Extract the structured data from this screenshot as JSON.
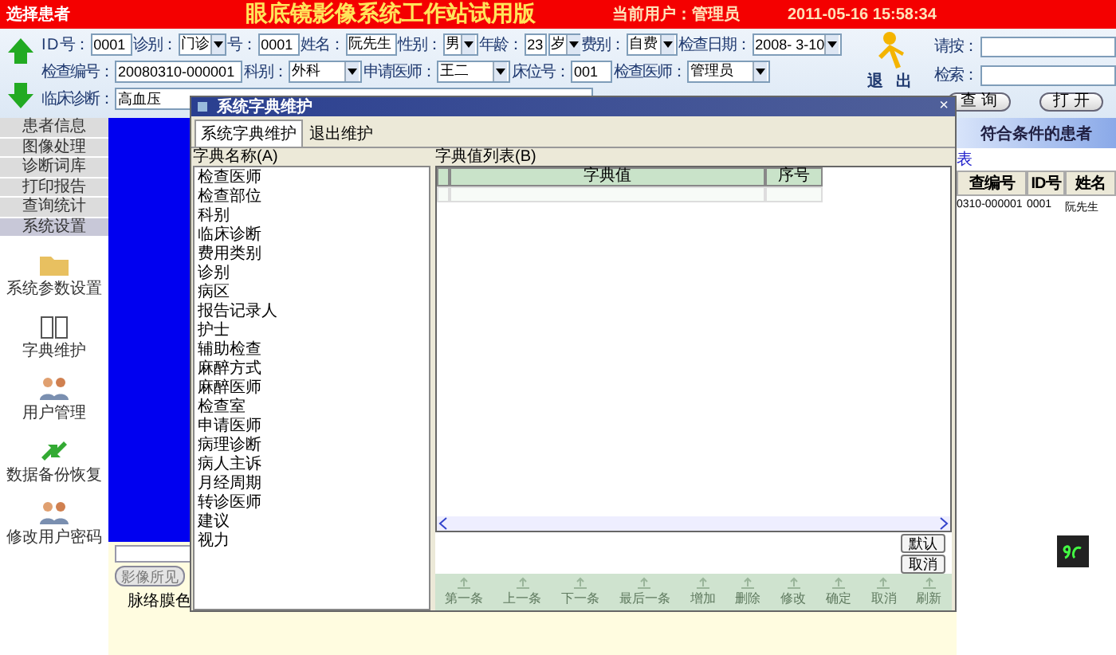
{
  "header": {
    "left_label": "选择患者",
    "title": "眼底镜影像系统工作站试用版",
    "user": "当前用户：管理员",
    "datetime": "2011-05-16 15:58:34"
  },
  "form": {
    "rows": [
      {
        "fields": [
          {
            "label": "I D 号：",
            "value": "0001",
            "kind": "text"
          },
          {
            "label": "诊别：",
            "value": "门诊",
            "kind": "select"
          },
          {
            "label": "号：",
            "value": "0001",
            "kind": "text"
          },
          {
            "label": "姓名：",
            "value": "阮先生",
            "kind": "text"
          },
          {
            "label": "性别：",
            "value": "男",
            "kind": "select"
          },
          {
            "label": "年龄：",
            "value": "23",
            "kind": "text"
          },
          {
            "value": "岁",
            "kind": "select"
          },
          {
            "label": "费别：",
            "value": "自费",
            "kind": "select"
          },
          {
            "label": "检查日期：",
            "value": "2008- 3-10",
            "kind": "select"
          }
        ]
      },
      {
        "fields": [
          {
            "label": "检查编号：",
            "value": "20080310-000001",
            "kind": "text"
          },
          {
            "label": "科别：",
            "value": "外科",
            "kind": "select"
          },
          {
            "label": "申请医师：",
            "value": "王二",
            "kind": "select"
          },
          {
            "label": "床位号：",
            "value": "001",
            "kind": "text"
          },
          {
            "label": "检查医师：",
            "value": "管理员",
            "kind": "select"
          }
        ]
      },
      {
        "fields": [
          {
            "label": "临床诊断：",
            "value": "高血压",
            "kind": "text"
          }
        ]
      }
    ]
  },
  "exit_button": [
    "退",
    "出"
  ],
  "search": {
    "fields": [
      {
        "label": "请按："
      },
      {
        "label": "检索："
      }
    ],
    "buttons": [
      "查 询",
      "打 开"
    ]
  },
  "nav": {
    "menu": [
      {
        "label": "患者信息",
        "selected": false
      },
      {
        "label": "图像处理",
        "selected": false
      },
      {
        "label": "诊断词库",
        "selected": false
      },
      {
        "label": "打印报告",
        "selected": false
      },
      {
        "label": "查询统计",
        "selected": false
      },
      {
        "label": "系统设置",
        "selected": true
      }
    ],
    "tools": [
      {
        "label": "系统参数设置",
        "kind": "folder"
      },
      {
        "label": "字典维护",
        "kind": "book"
      },
      {
        "label": "用户管理",
        "kind": "users"
      },
      {
        "label": "数据备份恢复",
        "kind": "arrows"
      },
      {
        "label": "修改用户密码",
        "kind": "users"
      }
    ]
  },
  "report": {
    "buttons": [
      "影像所见"
    ],
    "text": "脉络膜色"
  },
  "results": {
    "title": "符合条件的患者",
    "caption": "表",
    "columns": [
      "查编号",
      "ID号",
      "姓名"
    ],
    "rows": [
      [
        "0310-000001",
        "0001",
        "阮先生"
      ]
    ]
  },
  "dialog": {
    "title": "系统字典维护",
    "close": "×",
    "tabs": [
      {
        "label": "系统字典维护",
        "selected": true
      },
      {
        "label": "退出维护",
        "selected": false
      }
    ],
    "names_label": "字典名称(A)",
    "names": [
      "检查医师",
      "检查部位",
      "科别",
      "临床诊断",
      "费用类别",
      "诊别",
      "病区",
      "报告记录人",
      "护士",
      "辅助检查",
      "麻醉方式",
      "麻醉医师",
      "检查室",
      "申请医师",
      "病理诊断",
      "病人主诉",
      "月经周期",
      "转诊医师",
      "建议",
      "视力"
    ],
    "values_label": "字典值列表(B)",
    "columns": [
      "字典值",
      "序号"
    ],
    "side_buttons": [
      "默认",
      "取消"
    ],
    "toolbar": [
      {
        "label": "第一条",
        "disabled": true
      },
      {
        "label": "上一条",
        "disabled": true
      },
      {
        "label": "下一条",
        "disabled": true
      },
      {
        "label": "最后一条",
        "disabled": true
      },
      {
        "label": "增加",
        "disabled": true
      },
      {
        "label": "删除",
        "disabled": true
      },
      {
        "label": "修改",
        "disabled": true
      },
      {
        "label": "确定",
        "disabled": true
      },
      {
        "label": "取消",
        "disabled": true
      },
      {
        "label": "刷新",
        "disabled": true
      }
    ]
  }
}
